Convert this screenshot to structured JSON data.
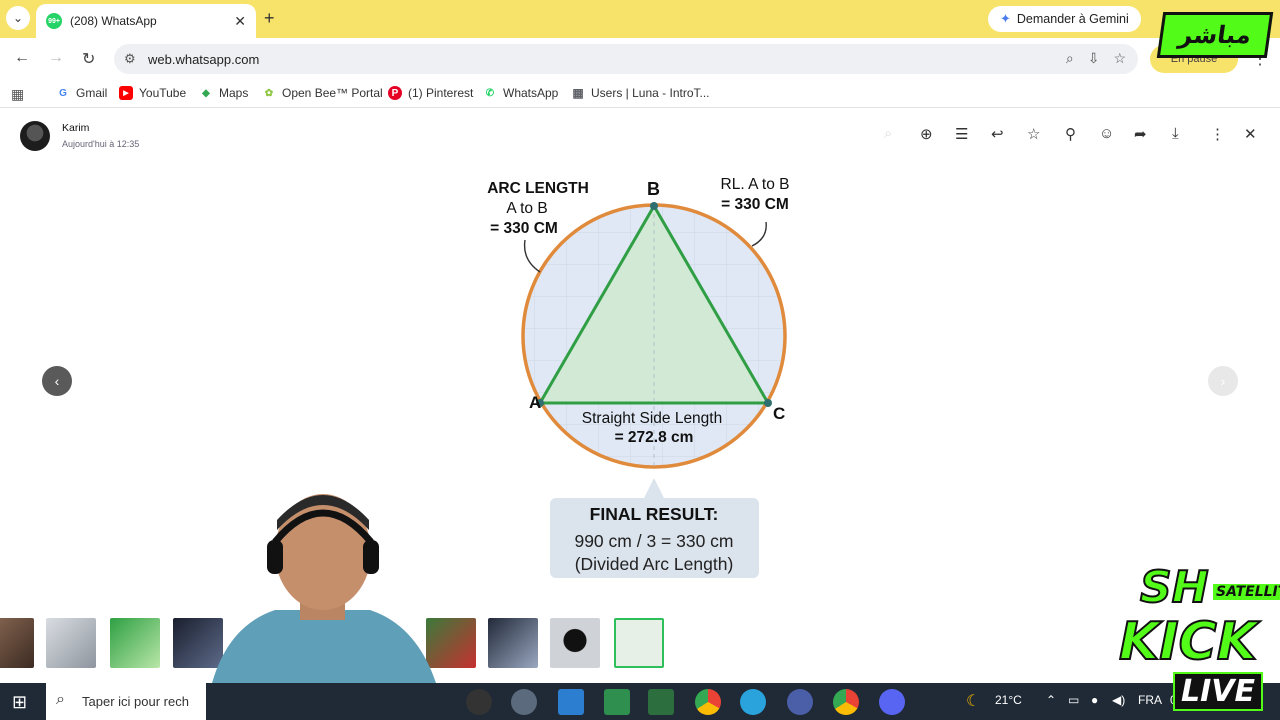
{
  "browser": {
    "tab_title": "(208) WhatsApp",
    "tab_badge": "99+",
    "tab_close": "✕",
    "new_tab": "+",
    "gemini_label": "Demander à Gemini",
    "url": "web.whatsapp.com",
    "profile_status": "En pause"
  },
  "bookmarks": [
    {
      "label": "Gmail",
      "icon": "gmail-icon",
      "color": "#4285f4",
      "glyph": "G"
    },
    {
      "label": "YouTube",
      "icon": "youtube-icon",
      "color": "#ff0000",
      "glyph": "▶"
    },
    {
      "label": "Maps",
      "icon": "maps-icon",
      "color": "#34a853",
      "glyph": "◆"
    },
    {
      "label": "Open Bee™ Portal",
      "icon": "openbee-icon",
      "color": "#8cc63f",
      "glyph": "✿"
    },
    {
      "label": "(1) Pinterest",
      "icon": "pinterest-icon",
      "color": "#e60023",
      "glyph": "P"
    },
    {
      "label": "WhatsApp",
      "icon": "whatsapp-icon",
      "color": "#25d366",
      "glyph": "✆"
    },
    {
      "label": "Users | Luna - IntroT...",
      "icon": "table-icon",
      "color": "#5f6368",
      "glyph": "▦"
    }
  ],
  "viewer": {
    "sender": "Karim",
    "time": "Aujourd'hui à 12:35"
  },
  "diagram": {
    "label_a": "A",
    "label_b": "B",
    "label_c": "C",
    "arc_title": "ARC LENGTH",
    "arc_sub": "A to B",
    "arc_value": "= 330 CM",
    "rl_title": "RL. A to B",
    "rl_value": "= 330 CM",
    "side_title": "Straight Side Length",
    "side_value": "= 272.8 cm",
    "result_title": "FINAL RESULT:",
    "result_line1": "990 cm / 3 = 330 cm",
    "result_line2": "(Divided Arc Length)"
  },
  "taskbar": {
    "search_placeholder": "Taper ici pour rech",
    "weather": "21°C",
    "language": "FRA",
    "clock_partial": "0"
  },
  "overlays": {
    "top_logo": "مباشر",
    "sh": "SH",
    "satellite": "SATELLITE",
    "kick": "KICK",
    "live": "LIVE"
  },
  "colors": {
    "chrome_tab_bar": "#f7e36a",
    "circle_stroke": "#e08a3c",
    "triangle_stroke": "#2f9e44",
    "kick_green": "#53fc18"
  }
}
